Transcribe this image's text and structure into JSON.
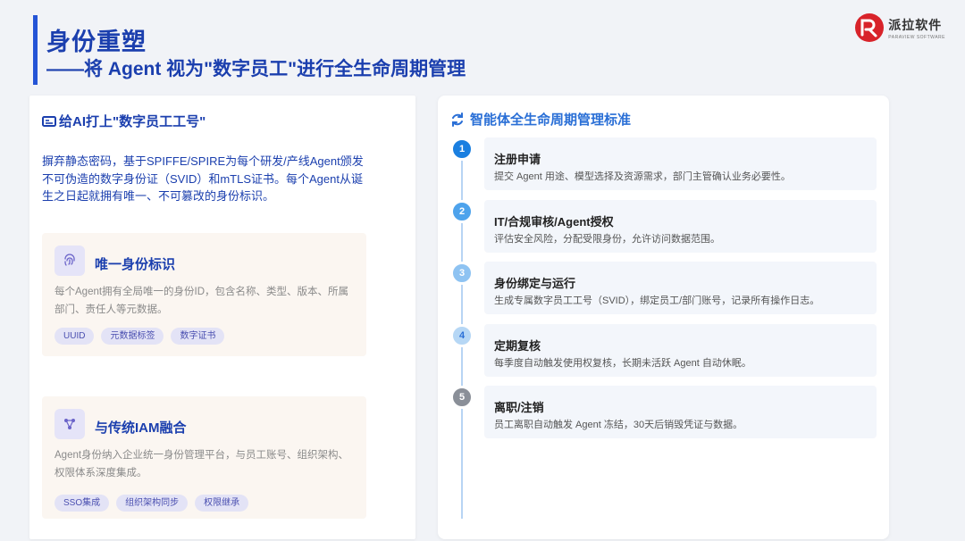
{
  "header": {
    "title_line1": "身份重塑",
    "title_line2": "——将 Agent 视为\"数字员工\"进行全生命周期管理"
  },
  "logo": {
    "name_cn": "派拉软件",
    "name_en": "PARAVIEW SOFTWARE",
    "brand_color": "#d8232a"
  },
  "left_panel": {
    "heading": "给AI打上\"数字员工工号\"",
    "description": "摒弃静态密码，基于SPIFFE/SPIRE为每个研发/产线Agent颁发不可伪造的数字身份证（SVID）和mTLS证书。每个Agent从诞生之日起就拥有唯一、不可篡改的身份标识。",
    "features": [
      {
        "icon": "fingerprint-icon",
        "title": "唯一身份标识",
        "description": "每个Agent拥有全局唯一的身份ID，包含名称、类型、版本、所属部门、责任人等元数据。",
        "tags": [
          "UUID",
          "元数据标签",
          "数字证书"
        ]
      },
      {
        "icon": "network-icon",
        "title": "与传统IAM融合",
        "description": "Agent身份纳入企业统一身份管理平台，与员工账号、组织架构、权限体系深度集成。",
        "tags": [
          "SSO集成",
          "组织架构同步",
          "权限继承"
        ]
      }
    ]
  },
  "right_panel": {
    "heading": "智能体全生命周期管理标准",
    "steps": [
      {
        "num": "1",
        "title": "注册申请",
        "description": "提交 Agent 用途、模型选择及资源需求，部门主管确认业务必要性。",
        "color": "#1a7fe0"
      },
      {
        "num": "2",
        "title": "IT/合规审核/Agent授权",
        "description": "评估安全风险，分配受限身份，允许访问数据范围。",
        "color": "#4ea3ec"
      },
      {
        "num": "3",
        "title": "身份绑定与运行",
        "description": "生成专属数字员工工号（SVID），绑定员工/部门账号，记录所有操作日志。",
        "color": "#8ec3f2"
      },
      {
        "num": "4",
        "title": "定期复核",
        "description": "每季度自动触发使用权复核，长期未活跃 Agent 自动休眠。",
        "color": "#b6d7f5"
      },
      {
        "num": "5",
        "title": "离职/注销",
        "description": "员工离职自动触发 Agent 冻结，30天后销毁凭证与数据。",
        "color": "#8a8f98"
      }
    ]
  }
}
